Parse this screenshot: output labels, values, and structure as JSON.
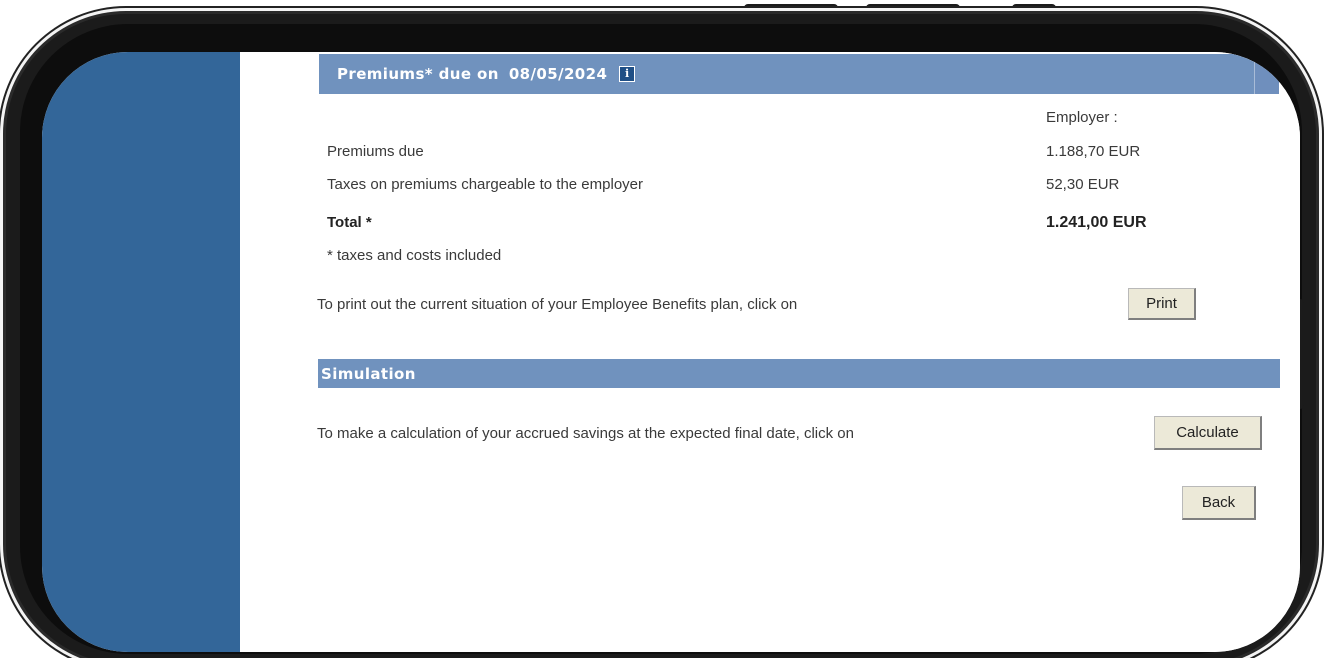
{
  "premiums": {
    "header_label": "Premiums* due on",
    "header_date": "08/05/2024",
    "info_icon": "info-icon",
    "column_header": "Employer :",
    "rows": [
      {
        "label": "Premiums due",
        "value": "1.188,70 EUR"
      },
      {
        "label": "Taxes on premiums chargeable to the employer",
        "value": "52,30 EUR"
      }
    ],
    "total_label": "Total *",
    "total_value": "1.241,00 EUR",
    "footnote": "* taxes and costs included",
    "print_text": "To print out the current situation of your Employee Benefits plan, click on",
    "print_button": "Print"
  },
  "simulation": {
    "header": "Simulation",
    "text": "To make a calculation of your accrued savings at the expected final date, click on",
    "calculate_button": "Calculate"
  },
  "navigation": {
    "back_button": "Back"
  },
  "colors": {
    "sidebar": "#336699",
    "header": "#7092be",
    "button_face": "#ece9d8"
  }
}
